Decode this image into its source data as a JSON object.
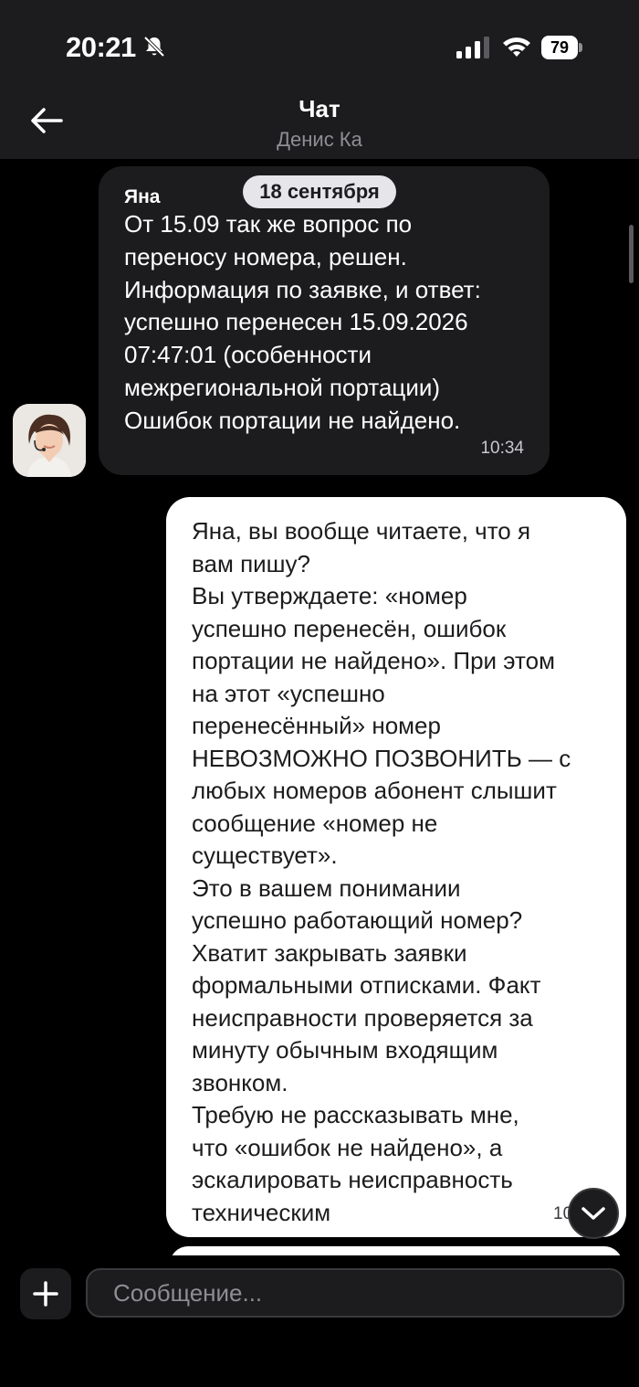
{
  "status_bar": {
    "time": "20:21",
    "battery": "79"
  },
  "header": {
    "title": "Чат",
    "subtitle": "Денис Ка"
  },
  "messages": [
    {
      "direction": "incoming",
      "sender": "Яна",
      "date": "18 сентября",
      "text": "От 15.09 так же вопрос по\nпереносу номера, решен.\nИнформация по заявке, и ответ:\nуспешно перенесен 15.09.2026\n07:47:01 (особенности\nмежрегиональной портации)\nОшибок портации не найдено.",
      "time": "10:34"
    },
    {
      "direction": "outgoing",
      "text": "Яна, вы вообще читаете, что я\nвам пишу?\nВы утверждаете: «номер\nуспешно перенесён, ошибок\nпортации не найдено». При этом\nна этот «успешно\nперенесённый» номер\nНЕВОЗМОЖНО ПОЗВОНИТЬ — с\nлюбых номеров абонент слышит\nсообщение «номер не\nсуществует».\nЭто в вашем понимании\nуспешно работающий номер?\nХватит закрывать заявки\nформальными отписками. Факт\nнеисправности проверяется за\nминуту обычным входящим\nзвонком.\nТребую не рассказывать мне,\nчто «ошибок не найдено», а\nэскалировать неисправность\nтехническим",
      "time_partial": "10"
    }
  ],
  "composer": {
    "placeholder": "Сообщение..."
  },
  "colors": {
    "background": "#000000",
    "bar": "#1c1c1e",
    "incoming_bubble": "#1c1c1e",
    "outgoing_bubble": "#ffffff"
  },
  "icons": [
    "bell-slash-icon",
    "signal-icon",
    "wifi-icon",
    "battery-icon",
    "back-arrow-icon",
    "chevron-down-icon",
    "plus-icon"
  ]
}
